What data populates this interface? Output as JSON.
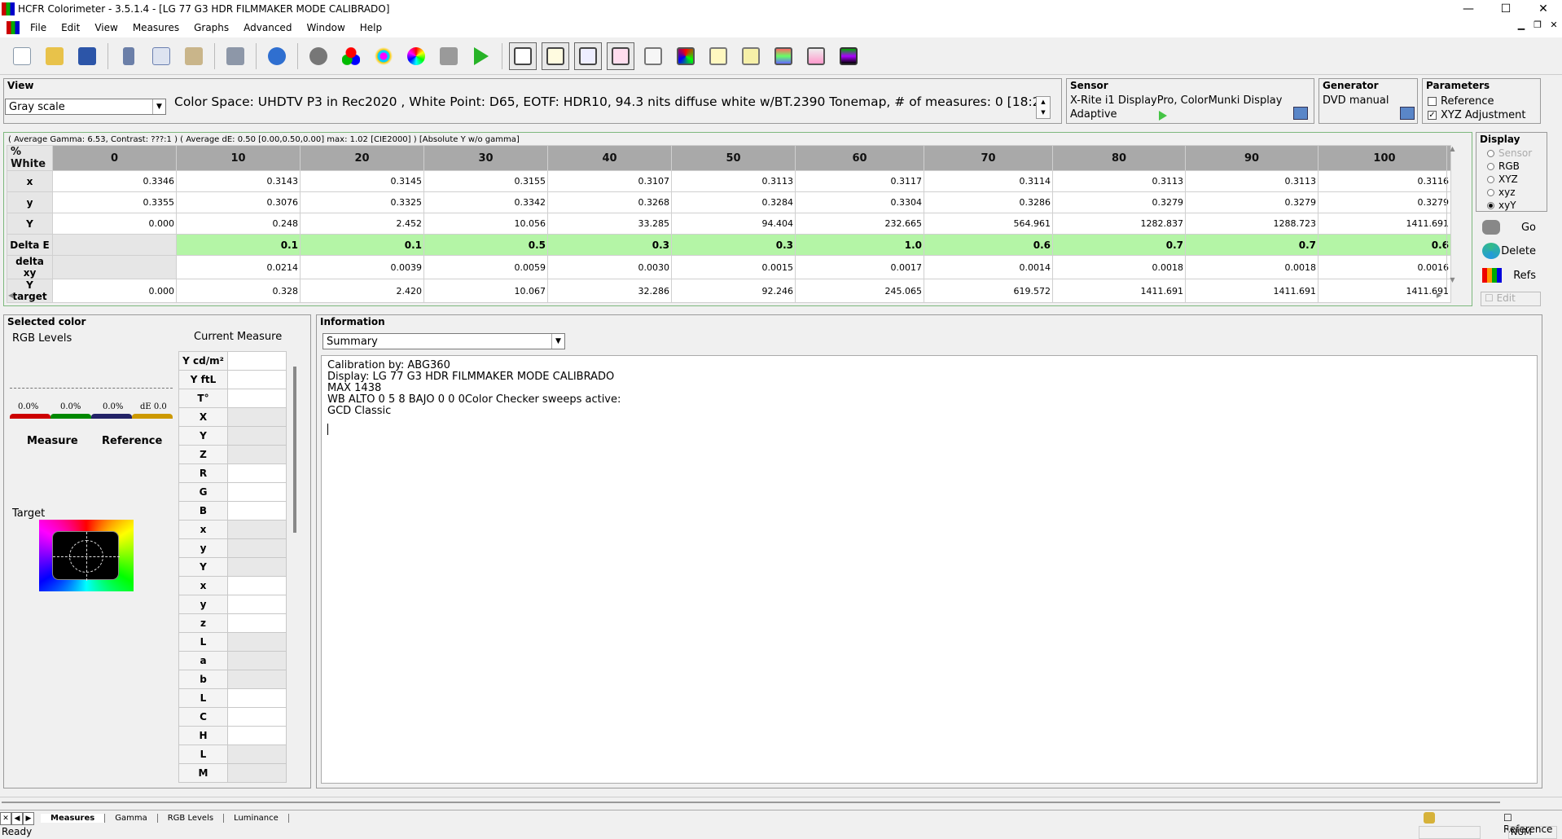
{
  "window": {
    "title": "HCFR Colorimeter - 3.5.1.4 - [LG 77 G3 HDR FILMMAKER MODE CALIBRADO]",
    "min": "—",
    "max": "☐",
    "close": "✕"
  },
  "menu": [
    "File",
    "Edit",
    "View",
    "Measures",
    "Graphs",
    "Advanced",
    "Window",
    "Help"
  ],
  "view": {
    "header": "View",
    "selected": "Gray scale",
    "colorspace": "Color Space: UHDTV P3 in Rec2020 , White Point: D65, EOTF:  HDR10, 94.3 nits diffuse white w/BT.2390 Tonemap, # of measures: 0 [18:2..."
  },
  "sensor": {
    "header": "Sensor",
    "name": "X-Rite i1 DisplayPro, ColorMunki Display",
    "mode": "Adaptive"
  },
  "generator": {
    "header": "Generator",
    "name": "DVD manual"
  },
  "parameters": {
    "header": "Parameters",
    "reference": "Reference",
    "xyz_adjustment": "XYZ Adjustment"
  },
  "stats": "( Average Gamma: 6.53, Contrast: ???:1 ) ( Average dE: 0.50 [0.00,0.50,0.00] max: 1.02 [CIE2000] ) [Absolute Y w/o gamma]",
  "grid": {
    "columns": [
      "% White",
      "0",
      "10",
      "20",
      "30",
      "40",
      "50",
      "60",
      "70",
      "80",
      "90",
      "100"
    ],
    "rows": [
      {
        "label": "x",
        "values": [
          "0.3346",
          "0.3143",
          "0.3145",
          "0.3155",
          "0.3107",
          "0.3113",
          "0.3117",
          "0.3114",
          "0.3113",
          "0.3113",
          "0.3116"
        ]
      },
      {
        "label": "y",
        "values": [
          "0.3355",
          "0.3076",
          "0.3325",
          "0.3342",
          "0.3268",
          "0.3284",
          "0.3304",
          "0.3286",
          "0.3279",
          "0.3279",
          "0.3279"
        ]
      },
      {
        "label": "Y",
        "values": [
          "0.000",
          "0.248",
          "2.452",
          "10.056",
          "33.285",
          "94.404",
          "232.665",
          "564.961",
          "1282.837",
          "1288.723",
          "1411.691"
        ]
      },
      {
        "label": "Delta E",
        "values": [
          "",
          "0.1",
          "0.1",
          "0.5",
          "0.3",
          "0.3",
          "1.0",
          "0.6",
          "0.7",
          "0.7",
          "0.6"
        ]
      },
      {
        "label": "delta xy",
        "values": [
          "",
          "0.0214",
          "0.0039",
          "0.0059",
          "0.0030",
          "0.0015",
          "0.0017",
          "0.0014",
          "0.0018",
          "0.0018",
          "0.0016"
        ]
      },
      {
        "label": "Y target",
        "values": [
          "0.000",
          "0.328",
          "2.420",
          "10.067",
          "32.286",
          "92.246",
          "245.065",
          "619.572",
          "1411.691",
          "1411.691",
          "1411.691"
        ]
      }
    ]
  },
  "display": {
    "header": "Display",
    "options": [
      "Sensor",
      "RGB",
      "XYZ",
      "xyz",
      "xyY"
    ],
    "go": "Go",
    "delete": "Delete",
    "refs": "Refs",
    "edit": "Edit"
  },
  "selected_color": {
    "header": "Selected color",
    "rgb_levels": "RGB Levels",
    "current_measure": "Current Measure",
    "r": "0.0%",
    "g": "0.0%",
    "b": "0.0%",
    "de": "dE 0.0",
    "measure": "Measure",
    "reference": "Reference",
    "target": "Target",
    "labels": [
      "Y cd/m²",
      "Y ftL",
      "T°",
      "X",
      "Y",
      "Z",
      "R",
      "G",
      "B",
      "x",
      "y",
      "Y",
      "x",
      "y",
      "z",
      "L",
      "a",
      "b",
      "L",
      "C",
      "H",
      "L",
      "M"
    ]
  },
  "information": {
    "header": "Information",
    "selected": "Summary",
    "lines": [
      "Calibration by: ABG360",
      "Display: LG 77 G3 HDR FILMMAKER MODE CALIBRADO",
      "MAX 1438",
      "WB ALTO 0 5 8 BAJO 0 0 0Color Checker sweeps active:",
      "GCD Classic"
    ]
  },
  "tabs": [
    "Measures",
    "Gamma",
    "RGB Levels",
    "Luminance"
  ],
  "bottom_reference": "Reference",
  "status": {
    "text": "Ready",
    "num": "NUM"
  },
  "colors": {
    "delta_e_bg": "#b4f5a6",
    "header_grey": "#a9a9a9"
  }
}
